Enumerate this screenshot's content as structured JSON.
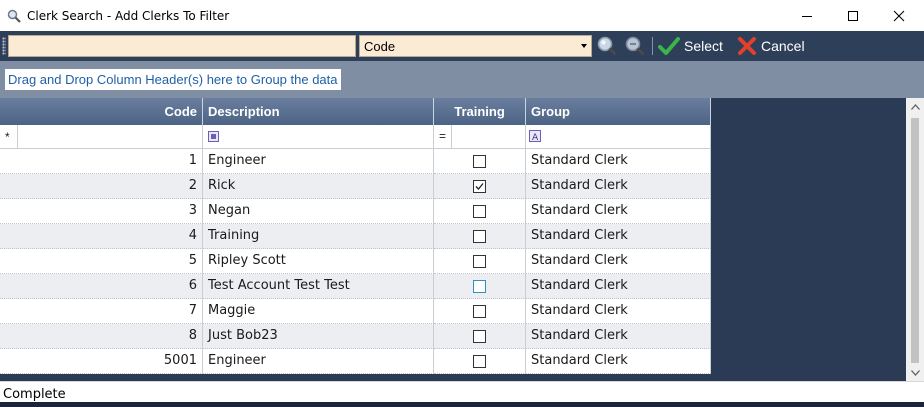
{
  "window": {
    "title": "Clerk Search - Add Clerks To Filter",
    "icon": "magnifier-icon"
  },
  "toolbar": {
    "search_value": "",
    "search_field_value": "Code",
    "select_label": "Select",
    "cancel_label": "Cancel",
    "colors": {
      "background": "#2e3f59",
      "input_bg": "#fbebd5"
    }
  },
  "group_panel": {
    "hint": "Drag and Drop Column Header(s) here to Group the data"
  },
  "grid": {
    "columns": [
      {
        "key": "code",
        "label": "Code"
      },
      {
        "key": "description",
        "label": "Description"
      },
      {
        "key": "training",
        "label": "Training"
      },
      {
        "key": "group",
        "label": "Group"
      }
    ],
    "filter_row": {
      "code_operator": "*",
      "training_operator": "="
    },
    "rows": [
      {
        "code": "1",
        "description": "Engineer",
        "training": false,
        "group": "Standard Clerk"
      },
      {
        "code": "2",
        "description": "Rick",
        "training": true,
        "group": "Standard Clerk"
      },
      {
        "code": "3",
        "description": "Negan",
        "training": false,
        "group": "Standard Clerk"
      },
      {
        "code": "4",
        "description": "Training",
        "training": false,
        "group": "Standard Clerk"
      },
      {
        "code": "5",
        "description": "Ripley Scott",
        "training": false,
        "group": "Standard Clerk"
      },
      {
        "code": "6",
        "description": "Test Account Test Test",
        "training": false,
        "group": "Standard Clerk"
      },
      {
        "code": "7",
        "description": "Maggie",
        "training": false,
        "group": "Standard Clerk"
      },
      {
        "code": "8",
        "description": "Just Bob23",
        "training": false,
        "group": "Standard Clerk"
      },
      {
        "code": "5001",
        "description": "Engineer",
        "training": false,
        "group": "Standard Clerk"
      }
    ]
  },
  "status": {
    "text": "Complete"
  }
}
